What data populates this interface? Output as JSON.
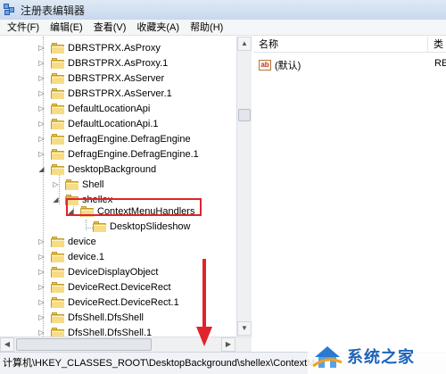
{
  "window": {
    "title": "注册表编辑器"
  },
  "menu": [
    {
      "label": "文件(F)"
    },
    {
      "label": "编辑(E)"
    },
    {
      "label": "查看(V)"
    },
    {
      "label": "收藏夹(A)"
    },
    {
      "label": "帮助(H)"
    }
  ],
  "tree": {
    "items": [
      {
        "label": "DBRSTPRX.AsProxy"
      },
      {
        "label": "DBRSTPRX.AsProxy.1"
      },
      {
        "label": "DBRSTPRX.AsServer"
      },
      {
        "label": "DBRSTPRX.AsServer.1"
      },
      {
        "label": "DefaultLocationApi"
      },
      {
        "label": "DefaultLocationApi.1"
      },
      {
        "label": "DefragEngine.DefragEngine"
      },
      {
        "label": "DefragEngine.DefragEngine.1"
      },
      {
        "label": "DesktopBackground"
      },
      {
        "label": "Shell"
      },
      {
        "label": "shellex"
      },
      {
        "label": "ContextMenuHandlers"
      },
      {
        "label": "DesktopSlideshow"
      },
      {
        "label": "device"
      },
      {
        "label": "device.1"
      },
      {
        "label": "DeviceDisplayObject"
      },
      {
        "label": "DeviceRect.DeviceRect"
      },
      {
        "label": "DeviceRect.DeviceRect.1"
      },
      {
        "label": "DfsShell.DfsShell"
      },
      {
        "label": "DfsShell.DfsShell.1"
      }
    ]
  },
  "right_pane": {
    "columns": [
      {
        "label": "名称"
      },
      {
        "label": "类"
      }
    ],
    "rows": [
      {
        "name": "(默认)",
        "data": "RE"
      }
    ]
  },
  "statusbar": {
    "path": "计算机\\HKEY_CLASSES_ROOT\\DesktopBackground\\shellex\\ContextM"
  },
  "watermark": {
    "text": "系统之家"
  },
  "colors": {
    "highlight_box": "#e0242b",
    "arrow": "#e0242b"
  },
  "icons": {
    "folder": "folder-icon",
    "expand": "chevron-right-icon",
    "collapse": "chevron-down-icon",
    "value": "string-value-icon"
  }
}
